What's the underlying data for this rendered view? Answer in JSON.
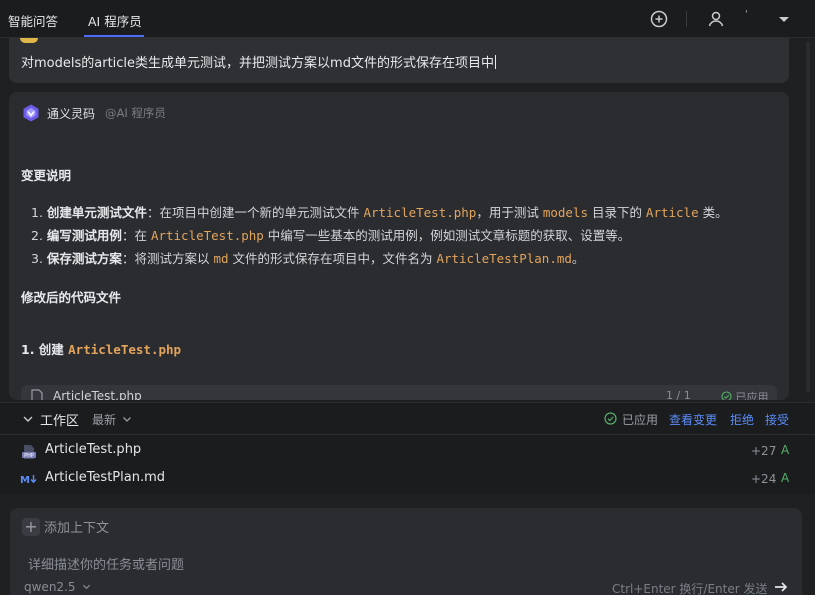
{
  "tabs": [
    {
      "label": "智能问答"
    },
    {
      "label": "AI 程序员"
    }
  ],
  "top_bar": {
    "user_name": "'",
    "icons": [
      "plus-circle-icon",
      "user-icon",
      "caret-down-icon"
    ]
  },
  "user_message": {
    "text": "对models的article类生成单元测试，并把测试方案以md文件的形式保存在项目中"
  },
  "answer": {
    "bot_name": "通义灵码",
    "bot_role": "@AI 程序员",
    "heading_changes": "变更说明",
    "items": [
      {
        "num": "1.",
        "bold": "创建单元测试文件",
        "sep": "：",
        "t1": "在项目中创建一个新的单元测试文件 ",
        "c1": "ArticleTest.php",
        "t2": "，用于测试 ",
        "c2": "models",
        "t3": " 目录下的 ",
        "c3": "Article",
        "t4": " 类。"
      },
      {
        "num": "2.",
        "bold": "编写测试用例",
        "sep": "：",
        "t1": "在 ",
        "c1": "ArticleTest.php",
        "t2": " 中编写一些基本的测试用例，例如测试文章标题的获取、设置等。"
      },
      {
        "num": "3.",
        "bold": "保存测试方案",
        "sep": "：",
        "t1": "将测试方案以 ",
        "c1": "md",
        "t2": " 文件的形式保存在项目中，文件名为 ",
        "c2": "ArticleTestPlan.md",
        "t3": "。"
      }
    ],
    "heading_files": "修改后的代码文件",
    "create_heading_prefix": "1. 创建 ",
    "create_heading_code": "ArticleTest.php",
    "file_peek": {
      "name": "ArticleTest.php",
      "count": "1 / 1",
      "status": "已应用"
    }
  },
  "workspace": {
    "title": "工作区",
    "sort_label": "最新",
    "applied_label": "已应用",
    "view_changes": "查看变更",
    "reject": "拒绝",
    "accept": "接受",
    "files": [
      {
        "name": "ArticleTest.php",
        "icon": "php-file-icon",
        "additions": "+27",
        "status": "A"
      },
      {
        "name": "ArticleTestPlan.md",
        "icon": "markdown-file-icon",
        "additions": "+24",
        "status": "A"
      }
    ]
  },
  "input": {
    "add_context": "添加上下文",
    "placeholder": "详细描述你的任务或者问题",
    "model": "qwen2.5",
    "send_hint": "Ctrl+Enter 换行/Enter 发送"
  },
  "colors": {
    "accent": "#4f6ef7",
    "link": "#5b8cf7",
    "code": "#e3a45c",
    "added": "#56b06b"
  }
}
